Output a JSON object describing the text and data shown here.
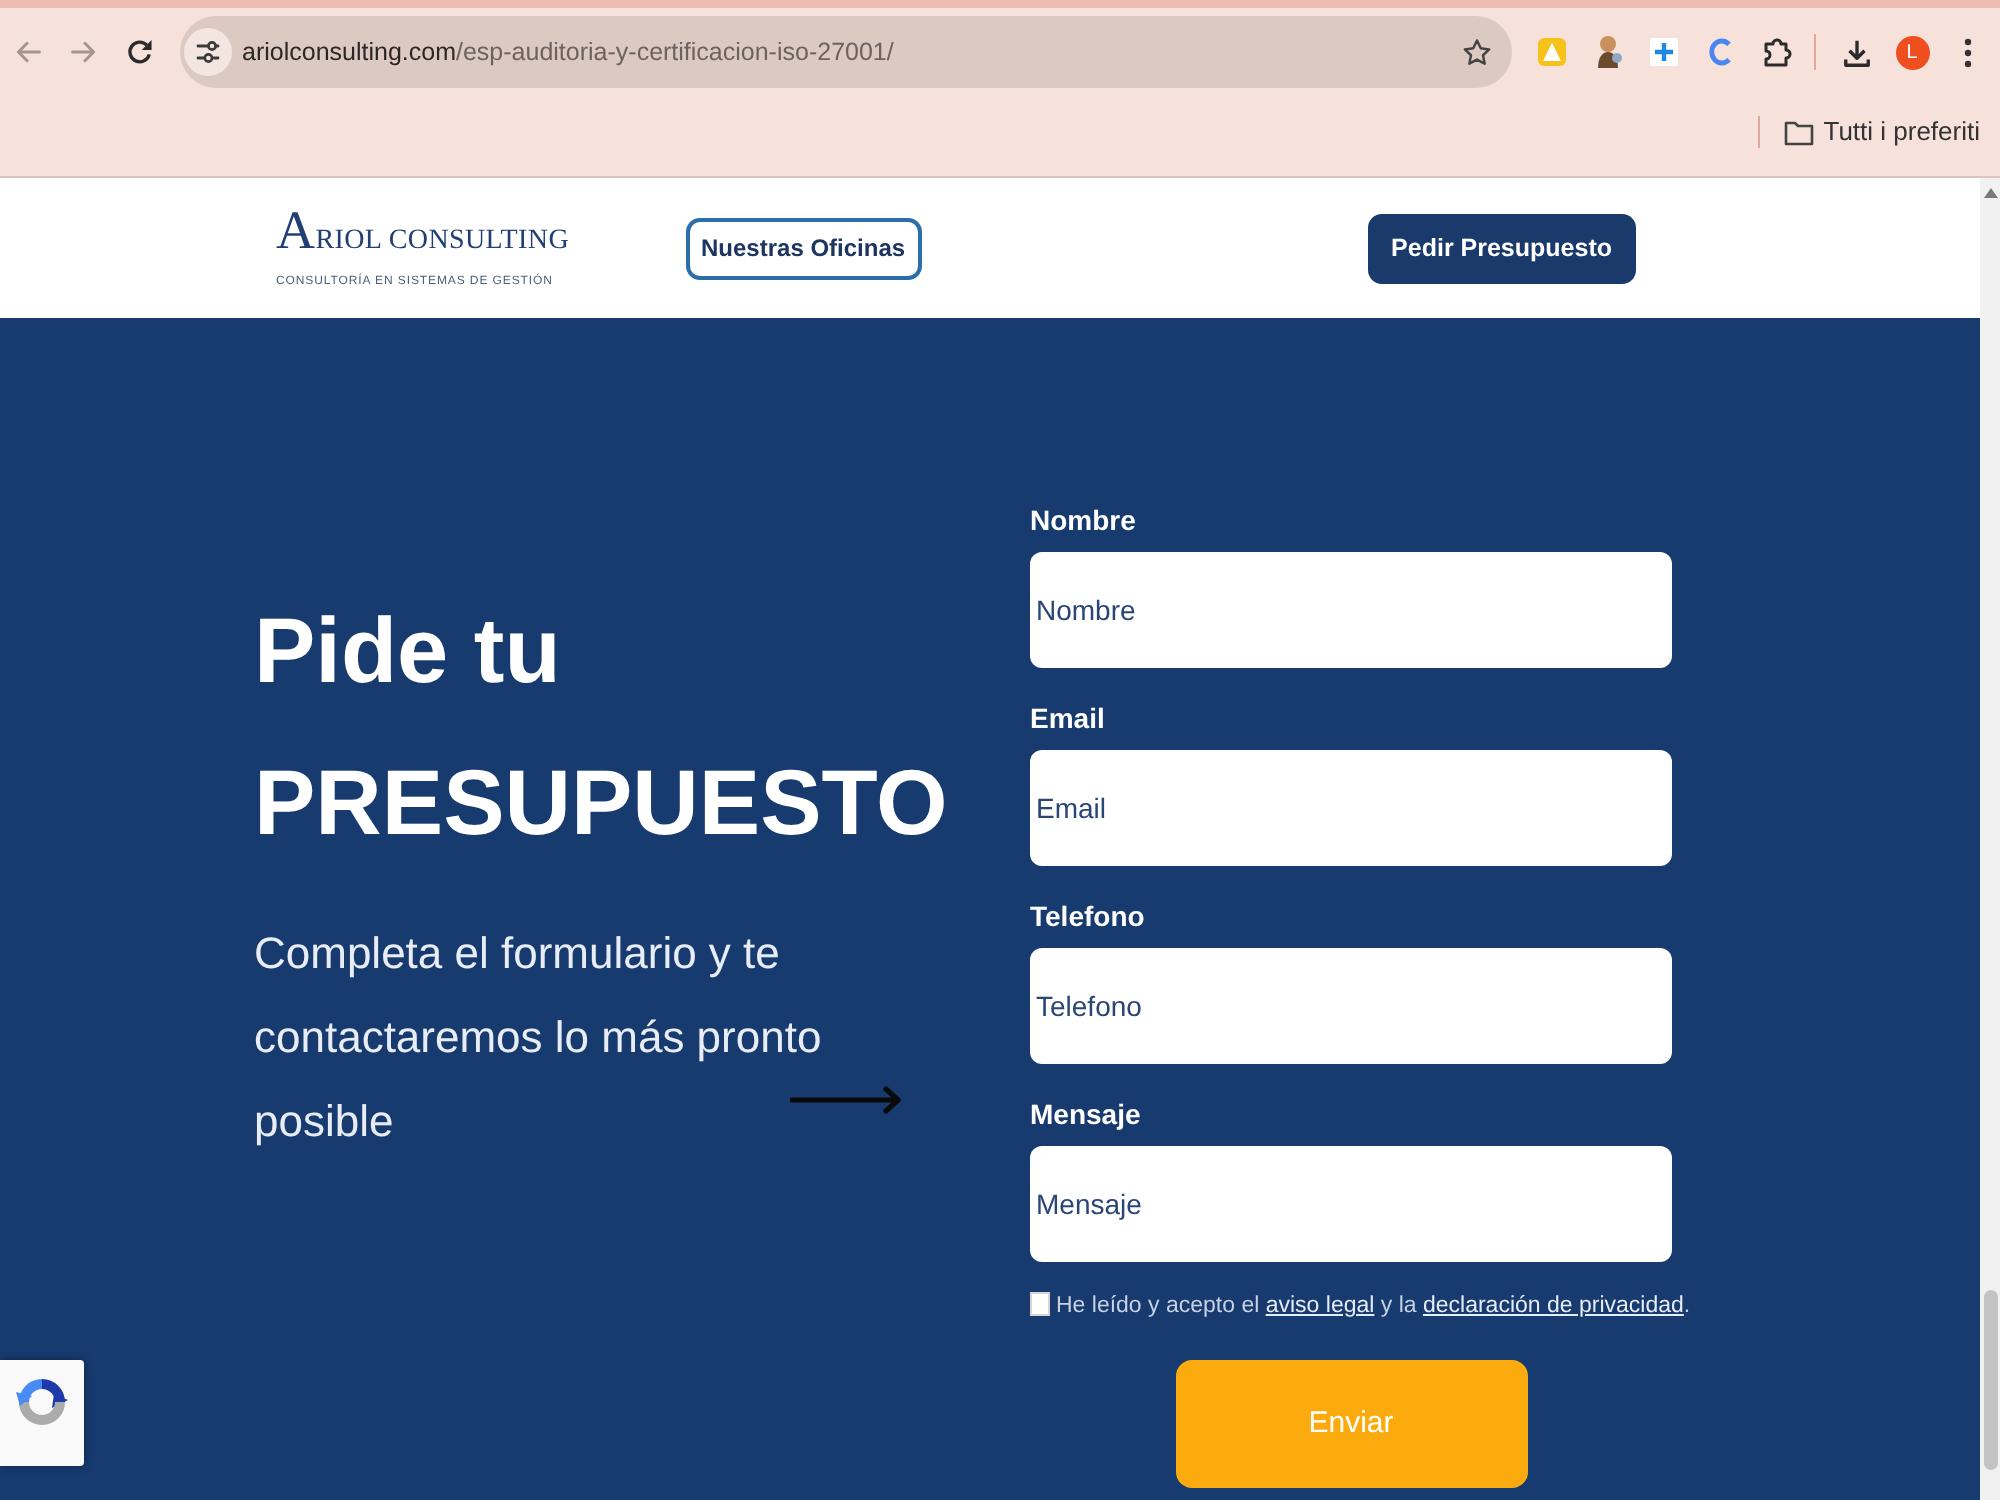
{
  "browser": {
    "url_host": "ariolconsulting.com",
    "url_path": "/esp-auditoria-y-certificacion-iso-27001/",
    "profile_initial": "L",
    "bookmarks_folder": "Tutti i preferiti"
  },
  "header": {
    "logo": {
      "name": "ARIOL CONSULTING",
      "tagline": "CONSULTORÍA EN SISTEMAS DE GESTIÓN"
    },
    "buttons": [
      {
        "label": "Nuestras Oficinas",
        "kind": "outline"
      },
      {
        "label": "Pedir Presupuesto",
        "kind": "solid"
      }
    ]
  },
  "hero": {
    "title": "Pide tu PRESUPUESTO",
    "subtitle": "Completa el formulario y te contactaremos lo más pronto posible"
  },
  "form": {
    "fields": [
      {
        "label": "Nombre",
        "placeholder": "Nombre"
      },
      {
        "label": "Email",
        "placeholder": "Email"
      },
      {
        "label": "Telefono",
        "placeholder": "Telefono"
      },
      {
        "label": "Mensaje",
        "placeholder": "Mensaje"
      }
    ],
    "consent": {
      "checked": false,
      "parts": [
        {
          "kind": "text",
          "text": "He leído y acepto el "
        },
        {
          "kind": "link",
          "text": "aviso legal"
        },
        {
          "kind": "text",
          "text": " y la "
        },
        {
          "kind": "link",
          "text": "declaración de privacidad"
        },
        {
          "kind": "text",
          "text": "."
        }
      ]
    },
    "submit": "Enviar"
  }
}
